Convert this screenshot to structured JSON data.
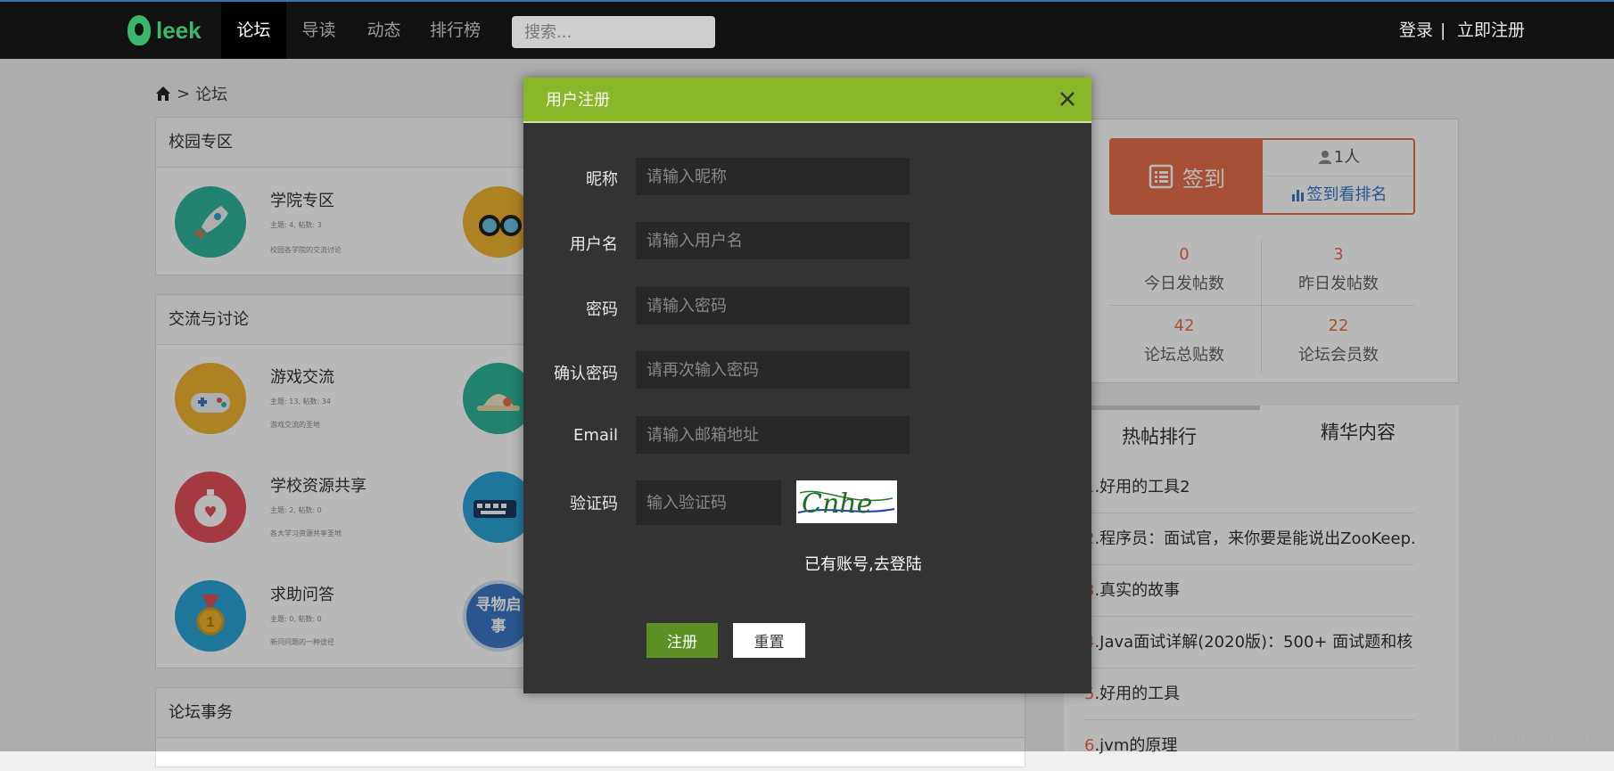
{
  "nav": {
    "logo_text": "leek",
    "items": [
      {
        "label": "论坛",
        "active": true
      },
      {
        "label": "导读",
        "active": false
      },
      {
        "label": "动态",
        "active": false
      },
      {
        "label": "排行榜",
        "active": false
      }
    ],
    "search_placeholder": "搜索...",
    "login": "登录",
    "separator": "|",
    "register": "立即注册"
  },
  "breadcrumb": {
    "current": "论坛",
    "sep": ">"
  },
  "sections": [
    {
      "title": "校园专区",
      "forums": [
        {
          "name": "学院专区",
          "meta": "主题: 4, 帖数: 3",
          "desc": "校园各学院的交流讨论",
          "icon": "rocket-icon",
          "color": "#2fb49a"
        },
        {
          "name": "",
          "meta": "",
          "desc": "",
          "icon": "glasses-icon",
          "color": "#f0b430"
        }
      ]
    },
    {
      "title": "交流与讨论",
      "forums": [
        {
          "name": "游戏交流",
          "meta": "主题: 13, 帖数: 34",
          "desc": "游戏交流的圣地",
          "icon": "gamepad-icon",
          "color": "#f0b430"
        },
        {
          "name": "",
          "meta": "",
          "desc": "",
          "icon": "hat-icon",
          "color": "#2fb49a"
        },
        {
          "name": "学校资源共享",
          "meta": "主题: 2, 帖数: 0",
          "desc": "各大学习资源共享圣地",
          "icon": "stopwatch-icon",
          "color": "#e5505a"
        },
        {
          "name": "",
          "meta": "",
          "desc": "",
          "icon": "keyboard-icon",
          "color": "#2aa6d6"
        },
        {
          "name": "求助问答",
          "meta": "主题: 0, 帖数: 0",
          "desc": "新问问题的一种途径",
          "icon": "medal-icon",
          "color": "#2aa6d6"
        },
        {
          "name": "",
          "meta": "",
          "desc": "",
          "icon": "lost-found-icon",
          "color": "#3b78c4",
          "badge_text": "寻物启事"
        }
      ]
    },
    {
      "title": "论坛事务",
      "forums": []
    }
  ],
  "sign": {
    "button": "签到",
    "count": "1人",
    "rank": "签到看排名"
  },
  "stats": [
    {
      "num": "0",
      "label": "今日发帖数"
    },
    {
      "num": "3",
      "label": "昨日发帖数"
    },
    {
      "num": "42",
      "label": "论坛总贴数"
    },
    {
      "num": "22",
      "label": "论坛会员数"
    }
  ],
  "hot": {
    "tabs": [
      "热帖排行",
      "精华内容"
    ],
    "items": [
      {
        "rank": "1",
        "title": ".好用的工具2"
      },
      {
        "rank": "2",
        "title": ".程序员：面试官，来你要是能说出ZooKeep..."
      },
      {
        "rank": "3",
        "title": ".真实的故事"
      },
      {
        "rank": "4",
        "title": ".Java面试详解(2020版)：500+ 面试题和核..."
      },
      {
        "rank": "5",
        "title": ".好用的工具"
      },
      {
        "rank": "6",
        "title": ".jvm的原理"
      }
    ]
  },
  "modal": {
    "title": "用户注册",
    "fields": [
      {
        "label": "昵称",
        "placeholder": "请输入昵称"
      },
      {
        "label": "用户名",
        "placeholder": "请输入用户名"
      },
      {
        "label": "密码",
        "placeholder": "请输入密码"
      },
      {
        "label": "确认密码",
        "placeholder": "请再次输入密码"
      },
      {
        "label": "Email",
        "placeholder": "请输入邮箱地址"
      },
      {
        "label": "验证码",
        "placeholder": "输入验证码"
      }
    ],
    "captcha_text": "Cnhe",
    "to_login": "已有账号,去登陆",
    "submit": "注册",
    "reset": "重置"
  },
  "watermark": "@稀土掘金技术社区",
  "colors": {
    "accent": "#8ab72a",
    "orange": "#e9704a",
    "link": "#3b78c4"
  }
}
